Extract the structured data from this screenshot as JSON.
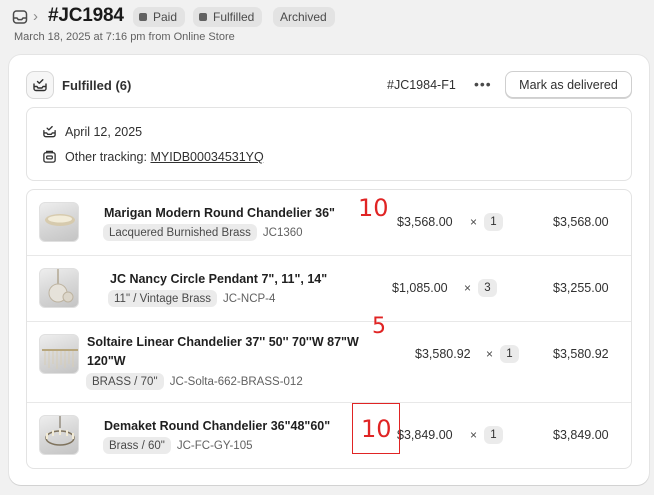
{
  "header": {
    "order_icon": "inbox-icon",
    "title": "#JC1984",
    "badges": [
      "Paid",
      "Fulfilled",
      "Archived"
    ],
    "subtitle": "March 18, 2025 at 7:16 pm from Online Store"
  },
  "fulfillment": {
    "title": "Fulfilled (6)",
    "id": "#JC1984-F1",
    "more_label": "•••",
    "deliver_button": "Mark as delivered",
    "date": "April 12, 2025",
    "tracking_label": "Other tracking:",
    "tracking_number": "MYIDB00034531YQ"
  },
  "items": [
    {
      "name": "Marigan Modern Round Chandelier 36\"",
      "variant": "Lacquered Burnished Brass",
      "sku": "JC1360",
      "price": "$3,568.00",
      "times": "×",
      "qty": "1",
      "total": "$3,568.00",
      "annotation": "10"
    },
    {
      "name": "JC Nancy Circle Pendant 7\", 11\", 14\"",
      "variant": "11\" / Vintage Brass",
      "sku": "JC-NCP-4",
      "price": "$1,085.00",
      "times": "×",
      "qty": "3",
      "total": "$3,255.00"
    },
    {
      "name_line1": "Soltaire Linear Chandelier 37'' 50'' 70''W 87\"W",
      "name_line2": "120\"W",
      "variant": "BRASS / 70''",
      "sku": "JC-Solta-662-BRASS-012",
      "price": "$3,580.92",
      "times": "×",
      "qty": "1",
      "total": "$3,580.92",
      "annotation": "5"
    },
    {
      "name": "Demaket Round Chandelier 36\"48\"60\"",
      "variant": "Brass / 60\"",
      "sku": "JC-FC-GY-105",
      "price": "$3,849.00",
      "times": "×",
      "qty": "1",
      "total": "$3,849.00",
      "annotation": "10"
    }
  ],
  "colors": {
    "annotation": "#e02424",
    "badge_bg": "#e3e3e3",
    "card_bg": "#ffffff",
    "page_bg": "#f1f1f1"
  }
}
